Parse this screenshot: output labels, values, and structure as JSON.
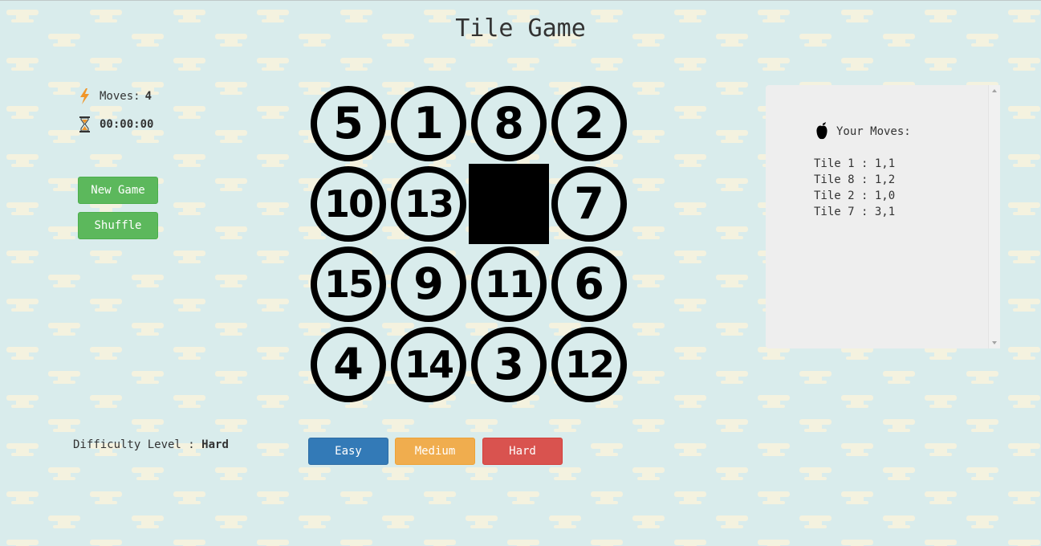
{
  "app": {
    "title": "Tile Game"
  },
  "stats": {
    "moves_label": "Moves:",
    "moves_value": "4",
    "timer_value": "00:00:00",
    "moves_icon": "lightning-icon",
    "timer_icon": "hourglass-icon"
  },
  "controls": {
    "new_game_label": "New Game",
    "shuffle_label": "Shuffle"
  },
  "board": {
    "rows": [
      [
        "5",
        "1",
        "8",
        "2"
      ],
      [
        "10",
        "13",
        "",
        "7"
      ],
      [
        "15",
        "9",
        "11",
        "6"
      ],
      [
        "4",
        "14",
        "3",
        "12"
      ]
    ]
  },
  "difficulty": {
    "label": "Difficulty Level :",
    "current": "Hard",
    "options": [
      "Easy",
      "Medium",
      "Hard"
    ]
  },
  "moves_panel": {
    "header": "Your Moves:",
    "icon": "apple-icon",
    "entries": [
      "Tile 1 : 1,1",
      "Tile 8 : 1,2",
      "Tile 2 : 1,0",
      "Tile 7 : 3,1"
    ]
  },
  "colors": {
    "background": "#d9ecec",
    "pattern": "#f4f2df",
    "green": "#5cb85c",
    "blue": "#337ab7",
    "orange": "#f0ad4e",
    "red": "#d9534f",
    "panel": "#eeeeee"
  }
}
